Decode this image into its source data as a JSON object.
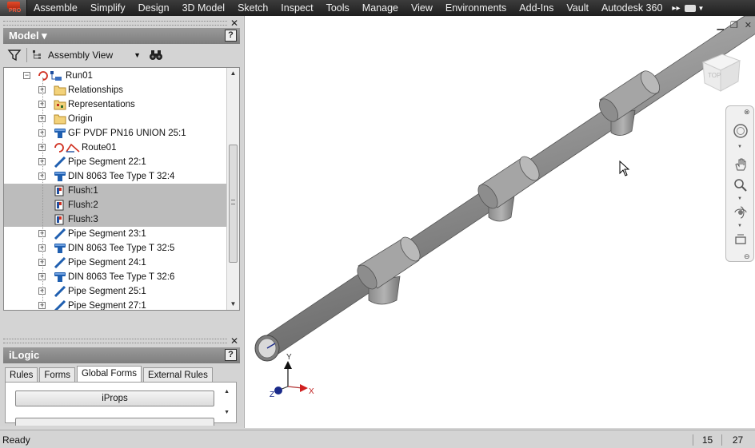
{
  "menubar": {
    "app_button": "PRO",
    "tabs": [
      "Assemble",
      "Simplify",
      "Design",
      "3D Model",
      "Sketch",
      "Inspect",
      "Tools",
      "Manage",
      "View",
      "Environments",
      "Add-Ins",
      "Vault",
      "Autodesk 360"
    ]
  },
  "browser": {
    "title": "Model ▾",
    "help": "?",
    "view_label": "Assembly View",
    "tree": [
      {
        "label": "Run01",
        "icon": "run-icon",
        "level": 0,
        "expander": "−",
        "selected": false
      },
      {
        "label": "Relationships",
        "icon": "folder-icon",
        "level": 1,
        "expander": "+",
        "selected": false
      },
      {
        "label": "Representations",
        "icon": "representations-icon",
        "level": 1,
        "expander": "+",
        "selected": false
      },
      {
        "label": "Origin",
        "icon": "folder-icon",
        "level": 1,
        "expander": "+",
        "selected": false
      },
      {
        "label": "GF PVDF PN16 UNION 25:1",
        "icon": "fitting-icon",
        "level": 1,
        "expander": "+",
        "selected": false
      },
      {
        "label": "Route01",
        "icon": "route-icon",
        "level": 1,
        "expander": "+",
        "selected": false
      },
      {
        "label": "Pipe Segment 22:1",
        "icon": "pipe-icon",
        "level": 1,
        "expander": "+",
        "selected": false
      },
      {
        "label": "DIN 8063 Tee Type T 32:4",
        "icon": "fitting-icon",
        "level": 1,
        "expander": "+",
        "selected": false
      },
      {
        "label": "Flush:1",
        "icon": "flush-icon",
        "level": 1,
        "expander": "",
        "selected": true
      },
      {
        "label": "Flush:2",
        "icon": "flush-icon",
        "level": 1,
        "expander": "",
        "selected": true
      },
      {
        "label": "Flush:3",
        "icon": "flush-icon",
        "level": 1,
        "expander": "",
        "selected": true
      },
      {
        "label": "Pipe Segment 23:1",
        "icon": "pipe-icon",
        "level": 1,
        "expander": "+",
        "selected": false
      },
      {
        "label": "DIN 8063 Tee Type T 32:5",
        "icon": "fitting-icon",
        "level": 1,
        "expander": "+",
        "selected": false
      },
      {
        "label": "Pipe Segment 24:1",
        "icon": "pipe-icon",
        "level": 1,
        "expander": "+",
        "selected": false
      },
      {
        "label": "DIN 8063 Tee Type T 32:6",
        "icon": "fitting-icon",
        "level": 1,
        "expander": "+",
        "selected": false
      },
      {
        "label": "Pipe Segment 25:1",
        "icon": "pipe-icon",
        "level": 1,
        "expander": "+",
        "selected": false
      },
      {
        "label": "Pipe Segment 27:1",
        "icon": "pipe-icon",
        "level": 1,
        "expander": "+",
        "selected": false
      }
    ]
  },
  "ilogic": {
    "title": "iLogic",
    "help": "?",
    "tabs": [
      {
        "label": "Rules",
        "active": false
      },
      {
        "label": "Forms",
        "active": false
      },
      {
        "label": "Global Forms",
        "active": true
      },
      {
        "label": "External Rules",
        "active": false
      }
    ],
    "button_iprops": "iProps"
  },
  "viewport": {
    "viewcube_face": "TOP",
    "axis_x": "X",
    "axis_y": "Y",
    "axis_z": "Z"
  },
  "status": {
    "text": "Ready",
    "count1": "15",
    "count2": "27"
  },
  "colors": {
    "menubar_bg": "#2a2a2a",
    "selection": "#bcbcbc",
    "pipe": "#8c8c8c",
    "axis_x": "#d02020",
    "axis_y": "#111111",
    "axis_z": "#1a2a8a"
  }
}
